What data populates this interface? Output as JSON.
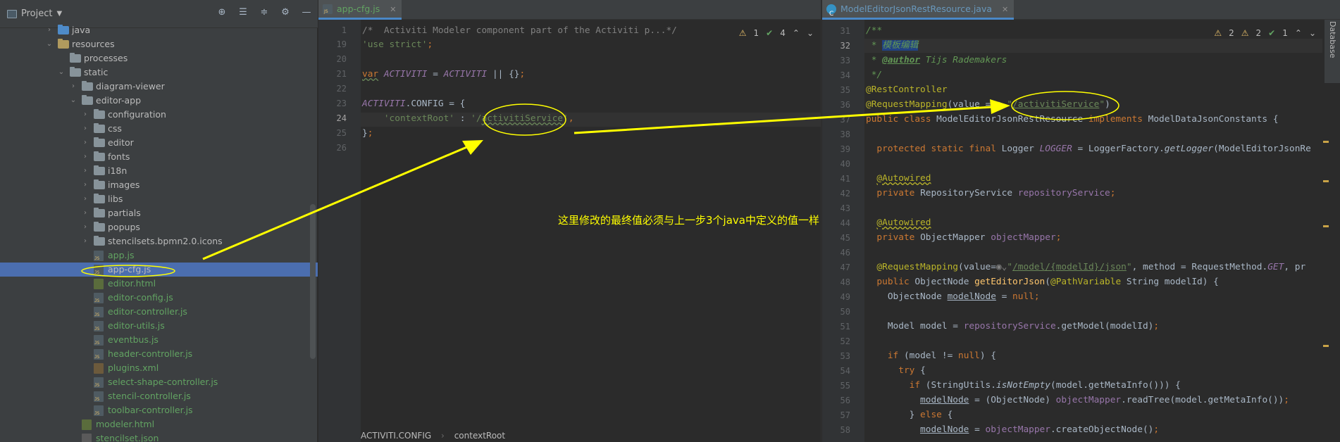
{
  "project_panel": {
    "title": "Project",
    "tools": [
      "target-icon",
      "expand-icon",
      "collapse-icon",
      "gear-icon",
      "minimize-icon"
    ],
    "tree": [
      {
        "label": "java",
        "depth": 3,
        "kind": "folder-src",
        "arrow": "right"
      },
      {
        "label": "resources",
        "depth": 3,
        "kind": "folder-res",
        "arrow": "down"
      },
      {
        "label": "processes",
        "depth": 4,
        "kind": "folder",
        "arrow": ""
      },
      {
        "label": "static",
        "depth": 4,
        "kind": "folder",
        "arrow": "down"
      },
      {
        "label": "diagram-viewer",
        "depth": 5,
        "kind": "folder",
        "arrow": "right"
      },
      {
        "label": "editor-app",
        "depth": 5,
        "kind": "folder",
        "arrow": "down"
      },
      {
        "label": "configuration",
        "depth": 6,
        "kind": "folder",
        "arrow": "right"
      },
      {
        "label": "css",
        "depth": 6,
        "kind": "folder",
        "arrow": "right"
      },
      {
        "label": "editor",
        "depth": 6,
        "kind": "folder",
        "arrow": "right"
      },
      {
        "label": "fonts",
        "depth": 6,
        "kind": "folder",
        "arrow": "right"
      },
      {
        "label": "i18n",
        "depth": 6,
        "kind": "folder",
        "arrow": "right"
      },
      {
        "label": "images",
        "depth": 6,
        "kind": "folder",
        "arrow": "right"
      },
      {
        "label": "libs",
        "depth": 6,
        "kind": "folder",
        "arrow": "right"
      },
      {
        "label": "partials",
        "depth": 6,
        "kind": "folder",
        "arrow": "right"
      },
      {
        "label": "popups",
        "depth": 6,
        "kind": "folder",
        "arrow": "right"
      },
      {
        "label": "stencilsets.bpmn2.0.icons",
        "depth": 6,
        "kind": "folder",
        "arrow": "right"
      },
      {
        "label": "app.js",
        "depth": 6,
        "kind": "js",
        "arrow": ""
      },
      {
        "label": "app-cfg.js",
        "depth": 6,
        "kind": "js",
        "arrow": "",
        "selected": true
      },
      {
        "label": "editor.html",
        "depth": 6,
        "kind": "html",
        "arrow": ""
      },
      {
        "label": "editor-config.js",
        "depth": 6,
        "kind": "js",
        "arrow": ""
      },
      {
        "label": "editor-controller.js",
        "depth": 6,
        "kind": "js",
        "arrow": ""
      },
      {
        "label": "editor-utils.js",
        "depth": 6,
        "kind": "js",
        "arrow": ""
      },
      {
        "label": "eventbus.js",
        "depth": 6,
        "kind": "js",
        "arrow": ""
      },
      {
        "label": "header-controller.js",
        "depth": 6,
        "kind": "js",
        "arrow": ""
      },
      {
        "label": "plugins.xml",
        "depth": 6,
        "kind": "xml",
        "arrow": ""
      },
      {
        "label": "select-shape-controller.js",
        "depth": 6,
        "kind": "js",
        "arrow": ""
      },
      {
        "label": "stencil-controller.js",
        "depth": 6,
        "kind": "js",
        "arrow": ""
      },
      {
        "label": "toolbar-controller.js",
        "depth": 6,
        "kind": "js",
        "arrow": ""
      },
      {
        "label": "modeler.html",
        "depth": 5,
        "kind": "html",
        "arrow": ""
      },
      {
        "label": "stencilset.json",
        "depth": 5,
        "kind": "json",
        "arrow": ""
      }
    ]
  },
  "left_editor": {
    "tab_label": "app-cfg.js",
    "inspection": {
      "warnings": "1",
      "ok": "4"
    },
    "line_numbers": [
      "1",
      "19",
      "20",
      "21",
      "22",
      "23",
      "24",
      "25",
      "26"
    ],
    "current_line": "24",
    "breadcrumb": [
      "ACTIVITI.CONFIG",
      "contextRoot"
    ]
  },
  "right_editor": {
    "tab_label": "ModelEditorJsonRestResource.java",
    "inspection": {
      "warnings": "2",
      "weak": "2",
      "ok": "1"
    },
    "line_numbers": [
      "31",
      "32",
      "33",
      "34",
      "35",
      "36",
      "37",
      "38",
      "39",
      "40",
      "41",
      "42",
      "43",
      "44",
      "45",
      "46",
      "47",
      "48",
      "49",
      "50",
      "51",
      "52",
      "53",
      "54",
      "55",
      "56",
      "57",
      "58"
    ],
    "current_line": "32",
    "side_tool": "Database"
  },
  "annotation": {
    "text": "这里修改的最终值必须与上一步3个java中定义的值一样",
    "color": "#ffff00"
  },
  "colors": {
    "accent": "#4a88c7",
    "selection": "#4b6eaf",
    "annotation": "#ffff00"
  }
}
